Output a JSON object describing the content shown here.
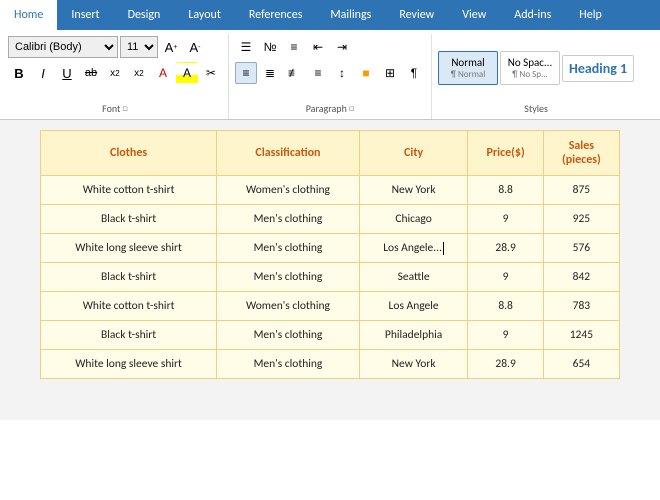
{
  "ribbon": {
    "tabs": [
      "Home",
      "Insert",
      "Design",
      "Layout",
      "References",
      "Mailings",
      "Review",
      "View",
      "Add-ins",
      "Help"
    ],
    "active_tab": "Home",
    "font_group": {
      "label": "Font",
      "font_name": "Calibri (Body)",
      "font_size": "11",
      "expand_title": "Font settings"
    },
    "paragraph_group": {
      "label": "Paragraph",
      "expand_title": "Paragraph settings"
    },
    "styles_group": {
      "label": "Styles",
      "normal_label": "Normal",
      "nospace_label": "No Spac...",
      "heading1_label": "Heading 1"
    }
  },
  "table": {
    "headers": [
      "Clothes",
      "Classification",
      "City",
      "Price($)",
      "Sales\n(pieces)"
    ],
    "rows": [
      [
        "White cotton t-shirt",
        "Women's clothing",
        "New York",
        "8.8",
        "875"
      ],
      [
        "Black t-shirt",
        "Men's clothing",
        "Chicago",
        "9",
        "925"
      ],
      [
        "White long sleeve shirt",
        "Men's clothing",
        "Los Angele...",
        "28.9",
        "576"
      ],
      [
        "Black t-shirt",
        "Men's clothing",
        "Seattle",
        "9",
        "842"
      ],
      [
        "White cotton t-shirt",
        "Women's clothing",
        "Los Angele",
        "8.8",
        "783"
      ],
      [
        "Black t-shirt",
        "Men's clothing",
        "Philadelphia",
        "9",
        "1245"
      ],
      [
        "White long sleeve shirt",
        "Men's clothing",
        "New York",
        "28.9",
        "654"
      ]
    ]
  }
}
